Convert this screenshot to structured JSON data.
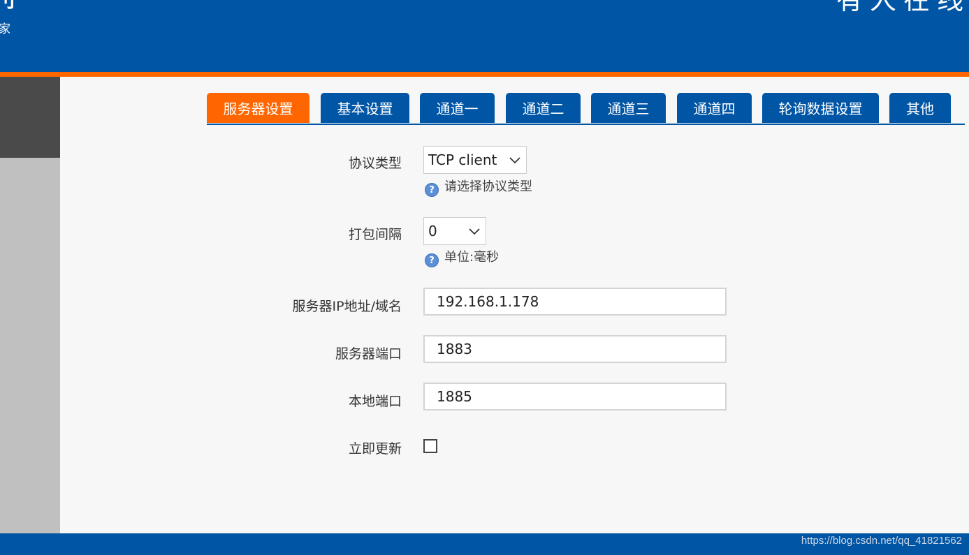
{
  "header": {
    "logo_glyph": "刂",
    "logo_sub": "家",
    "brand": "有人在线"
  },
  "tabs": [
    {
      "label": "服务器设置",
      "active": true
    },
    {
      "label": "基本设置",
      "active": false
    },
    {
      "label": "通道一",
      "active": false
    },
    {
      "label": "通道二",
      "active": false
    },
    {
      "label": "通道三",
      "active": false
    },
    {
      "label": "通道四",
      "active": false
    },
    {
      "label": "轮询数据设置",
      "active": false
    },
    {
      "label": "其他",
      "active": false
    }
  ],
  "form": {
    "protocol": {
      "label": "协议类型",
      "value": "TCP client",
      "hint": "请选择协议类型"
    },
    "pack_interval": {
      "label": "打包间隔",
      "value": "0",
      "hint": "单位:毫秒"
    },
    "server_ip": {
      "label": "服务器IP地址/域名",
      "value": "192.168.1.178"
    },
    "server_port": {
      "label": "服务器端口",
      "value": "1883"
    },
    "local_port": {
      "label": "本地端口",
      "value": "1885"
    },
    "update_now": {
      "label": "立即更新",
      "checked": false
    }
  },
  "footer": {
    "watermark": "https://blog.csdn.net/qq_41821562"
  },
  "colors": {
    "primary_blue": "#0055a5",
    "accent_orange": "#ff6600"
  },
  "icons": {
    "help": "question-circle-icon",
    "dropdown": "chevron-down-icon"
  }
}
